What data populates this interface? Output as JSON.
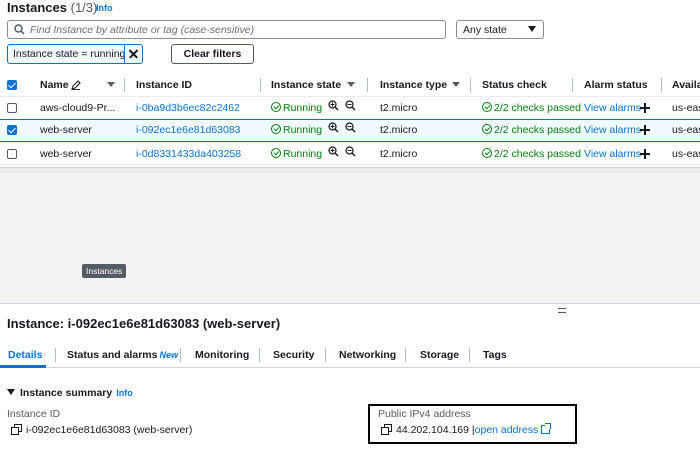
{
  "header": {
    "title": "Instances",
    "count": "(1/3)",
    "info": "Info"
  },
  "search": {
    "placeholder": "Find Instance by attribute or tag (case-sensitive)"
  },
  "state_filter": {
    "value": "Any state"
  },
  "filter_token": {
    "label": "Instance state = running"
  },
  "clear_filters": "Clear filters",
  "table": {
    "columns": [
      "Name",
      "Instance ID",
      "Instance state",
      "Instance type",
      "Status check",
      "Alarm status",
      "Availa"
    ],
    "rows": [
      {
        "selected": false,
        "name": "aws-cloud9-Pr...",
        "id": "i-0ba9d3b6ec82c2462",
        "state": "Running",
        "type": "t2.micro",
        "status": "2/2 checks passed",
        "alarm": "View alarms",
        "az": "us-east"
      },
      {
        "selected": true,
        "name": "web-server",
        "id": "i-092ec1e6e81d63083",
        "state": "Running",
        "type": "t2.micro",
        "status": "2/2 checks passed",
        "alarm": "View alarms",
        "az": "us-east"
      },
      {
        "selected": false,
        "name": "web-server",
        "id": "i-0d8331433da403258",
        "state": "Running",
        "type": "t2.micro",
        "status": "2/2 checks passed",
        "alarm": "View alarms",
        "az": "us-east"
      }
    ]
  },
  "tooltip": "Instances",
  "details": {
    "title": "Instance: i-092ec1e6e81d63083 (web-server)",
    "tabs": [
      "Details",
      "Status and alarms",
      "Monitoring",
      "Security",
      "Networking",
      "Storage",
      "Tags"
    ],
    "new_badge": "New",
    "summary_title": "Instance summary",
    "summary_info": "Info",
    "instance_id_label": "Instance ID",
    "instance_id_value": "i-092ec1e6e81d63083 (web-server)",
    "ipv4_label": "Public IPv4 address",
    "ipv4_value": "44.202.104.169",
    "open_address": "open address",
    "sep": "|"
  },
  "colors": {
    "link": "#0972d3",
    "success": "#037f0c",
    "selected_bg": "#f1faff"
  }
}
